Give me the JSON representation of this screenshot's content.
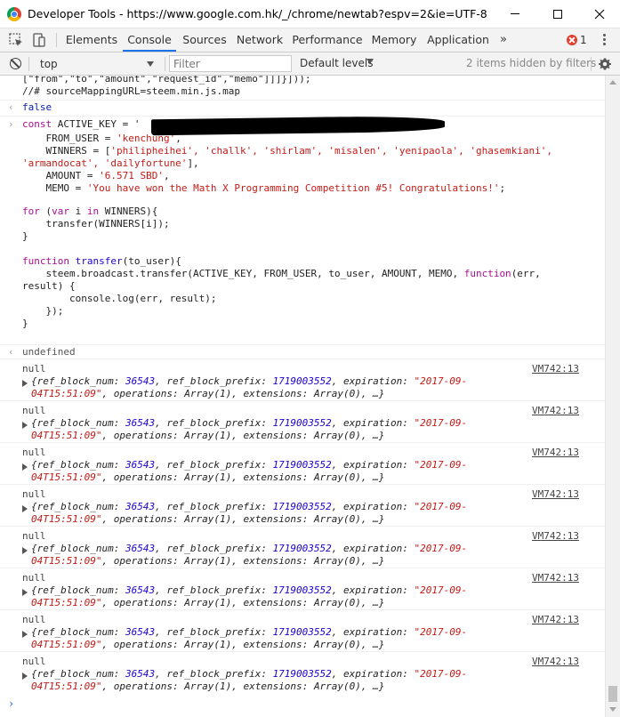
{
  "window": {
    "title": "Developer Tools - https://www.google.com.hk/_/chrome/newtab?espv=2&ie=UTF-8"
  },
  "tabs": [
    {
      "label": "Elements"
    },
    {
      "label": "Console"
    },
    {
      "label": "Sources"
    },
    {
      "label": "Network"
    },
    {
      "label": "Performance"
    },
    {
      "label": "Memory"
    },
    {
      "label": "Application"
    }
  ],
  "tabs_more": "»",
  "error_count": "1",
  "toolbar": {
    "context": "top",
    "filter_placeholder": "Filter",
    "levels": "Default levels",
    "hidden_info": "2 items hidden by filters"
  },
  "console": {
    "prev_line1": "[\"from\",\"to\",\"amount\",\"request_id\",\"memo\"]]]}]));",
    "prev_line2": "//# sourceMappingURL=steem.min.js.map",
    "result_false": "false",
    "code": {
      "l1_kw": "const",
      "l1_rest": " ACTIVE_KEY = '",
      "l2_a": "    FROM_USER = ",
      "l2_s": "'kenchung'",
      "l2_b": ",",
      "l3_a": "    WINNERS = [",
      "l3_s": "'philipheihei', 'challk', 'shirlam', 'misalen', 'yenipaola', 'ghasemkiani',",
      "l4_s": "'armandocat', 'dailyfortune'",
      "l4_b": "],",
      "l5_a": "    AMOUNT = ",
      "l5_s": "'6.571 SBD'",
      "l5_b": ",",
      "l6_a": "    MEMO = ",
      "l6_s": "'You have won the Math X Programming Competition #5! Congratulations!'",
      "l6_b": ";",
      "l8_kw1": "for",
      "l8_a": " (",
      "l8_kw2": "var",
      "l8_b": " i ",
      "l8_kw3": "in",
      "l8_c": " WINNERS){",
      "l9": "    transfer(WINNERS[i]);",
      "l10": "}",
      "l12_kw": "function",
      "l12_fn": " transfer",
      "l12_a": "(to_user){",
      "l13_a": "    steem.broadcast.transfer(ACTIVE_KEY, FROM_USER, to_user, AMOUNT, MEMO, ",
      "l13_kw": "function",
      "l13_b": "(err,",
      "l14": "result) {",
      "l15": "        console.log(err, result);",
      "l16": "    });",
      "l17": "}"
    },
    "result_undefined": "undefined",
    "log_entries": [
      {
        "label": "null",
        "source": "VM742:13",
        "block_num": "36543",
        "block_prefix": "1719003552",
        "exp_part1": "\"2017-09-",
        "exp_part2": "04T15:51:09\""
      },
      {
        "label": "null",
        "source": "VM742:13",
        "block_num": "36543",
        "block_prefix": "1719003552",
        "exp_part1": "\"2017-09-",
        "exp_part2": "04T15:51:09\""
      },
      {
        "label": "null",
        "source": "VM742:13",
        "block_num": "36543",
        "block_prefix": "1719003552",
        "exp_part1": "\"2017-09-",
        "exp_part2": "04T15:51:09\""
      },
      {
        "label": "null",
        "source": "VM742:13",
        "block_num": "36543",
        "block_prefix": "1719003552",
        "exp_part1": "\"2017-09-",
        "exp_part2": "04T15:51:09\""
      },
      {
        "label": "null",
        "source": "VM742:13",
        "block_num": "36543",
        "block_prefix": "1719003552",
        "exp_part1": "\"2017-09-",
        "exp_part2": "04T15:51:09\""
      },
      {
        "label": "null",
        "source": "VM742:13",
        "block_num": "36543",
        "block_prefix": "1719003552",
        "exp_part1": "\"2017-09-",
        "exp_part2": "04T15:51:09\""
      },
      {
        "label": "null",
        "source": "VM742:13",
        "block_num": "36543",
        "block_prefix": "1719003552",
        "exp_part1": "\"2017-09-",
        "exp_part2": "04T15:51:09\""
      },
      {
        "label": "null",
        "source": "VM742:13",
        "block_num": "36543",
        "block_prefix": "1719003552",
        "exp_part1": "\"2017-09-",
        "exp_part2": "04T15:51:09\""
      }
    ],
    "obj_text": {
      "open": "{",
      "k1": "ref_block_num",
      "k2": "ref_block_prefix",
      "k3": "expiration",
      "k4": "operations",
      "v4": "Array(1)",
      "k5": "extensions",
      "v5": "Array(0)",
      "tail": "…}",
      "colon": ": ",
      "comma": ", "
    },
    "input_prompt": "›"
  }
}
